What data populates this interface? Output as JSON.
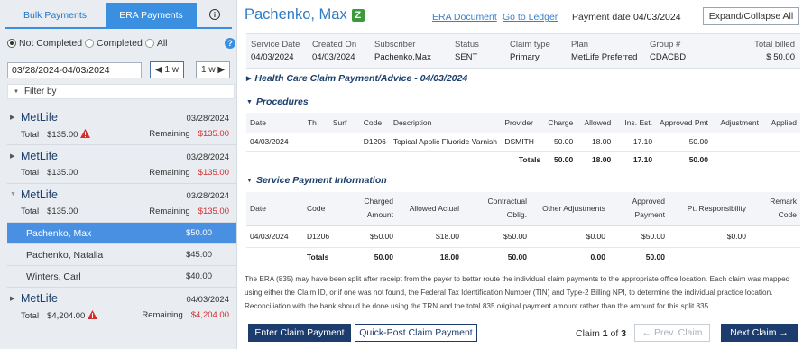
{
  "tabs": {
    "bulk": "Bulk Payments",
    "era": "ERA Payments",
    "info_icon": "i"
  },
  "filters": {
    "radios": [
      "Not Completed",
      "Completed",
      "All"
    ],
    "selected": "Not Completed",
    "date_range": "03/28/2024-04/03/2024",
    "prev_week": "1 w",
    "next_week": "1 w",
    "filter_by": "Filter by",
    "help_icon": "?"
  },
  "payers": [
    {
      "name": "MetLife",
      "date": "03/28/2024",
      "total_label": "Total",
      "total": "$135.00",
      "warning": true,
      "remaining_label": "Remaining",
      "remaining": "$135.00",
      "expanded": false
    },
    {
      "name": "MetLife",
      "date": "03/28/2024",
      "total_label": "Total",
      "total": "$135.00",
      "warning": false,
      "remaining_label": "Remaining",
      "remaining": "$135.00",
      "expanded": false
    },
    {
      "name": "MetLife",
      "date": "03/28/2024",
      "total_label": "Total",
      "total": "$135.00",
      "warning": false,
      "remaining_label": "Remaining",
      "remaining": "$135.00",
      "expanded": true,
      "claims": [
        {
          "name": "Pachenko, Max",
          "amount": "$50.00",
          "selected": true
        },
        {
          "name": "Pachenko, Natalia",
          "amount": "$45.00",
          "selected": false
        },
        {
          "name": "Winters, Carl",
          "amount": "$40.00",
          "selected": false
        }
      ]
    },
    {
      "name": "MetLife",
      "date": "04/03/2024",
      "total_label": "Total",
      "total": "$4,204.00",
      "warning": true,
      "remaining_label": "Remaining",
      "remaining": "$4,204.00",
      "expanded": false
    }
  ],
  "header": {
    "patient": "Pachenko, Max",
    "badge": "Z",
    "era_link": "ERA Document",
    "ledger_link": "Go to Ledger",
    "payment_date_label": "Payment date",
    "payment_date": "04/03/2024",
    "expand_btn": "Expand/Collapse All"
  },
  "summary": {
    "service_date": {
      "label": "Service Date",
      "value": "04/03/2024"
    },
    "created_on": {
      "label": "Created On",
      "value": "04/03/2024"
    },
    "subscriber": {
      "label": "Subscriber",
      "value": "Pachenko,Max"
    },
    "status": {
      "label": "Status",
      "value": "SENT"
    },
    "claim_type": {
      "label": "Claim type",
      "value": "Primary"
    },
    "plan": {
      "label": "Plan",
      "value": "MetLife Preferred"
    },
    "group": {
      "label": "Group #",
      "value": "CDACBD"
    },
    "total_billed": {
      "label": "Total billed",
      "value": "$ 50.00"
    }
  },
  "sections": {
    "advice": "Health Care Claim Payment/Advice - 04/03/2024",
    "procedures": "Procedures",
    "service_payment": "Service Payment Information"
  },
  "procedures": {
    "headers": [
      "Date",
      "Th",
      "Surf",
      "Code",
      "Description",
      "Provider",
      "Charge",
      "Allowed",
      "Ins. Est.",
      "Approved Pmt",
      "Adjustment",
      "Applied"
    ],
    "rows": [
      [
        "04/03/2024",
        "",
        "",
        "D1206",
        "Topical Applic Fluoride Varnish",
        "DSMITH",
        "50.00",
        "18.00",
        "17.10",
        "50.00",
        "",
        ""
      ]
    ],
    "totals": [
      "Totals",
      "50.00",
      "18.00",
      "17.10",
      "50.00"
    ]
  },
  "service_payment": {
    "headers": [
      "Date",
      "Code",
      "Charged Amount",
      "Allowed Actual",
      "Contractual Oblig.",
      "Other Adjustments",
      "Approved Payment",
      "Pt. Responsibility",
      "Remark Code"
    ],
    "rows": [
      [
        "04/03/2024",
        "D1206",
        "$50.00",
        "$18.00",
        "$50.00",
        "$0.00",
        "$50.00",
        "$0.00",
        ""
      ]
    ],
    "totals": [
      "Totals",
      "50.00",
      "18.00",
      "50.00",
      "0.00",
      "50.00"
    ]
  },
  "note": "The ERA (835) may have been split after receipt from the payer to better route the individual claim payments to the appropriate office location. Each claim was mapped using either the Claim ID, or if one was not found, the Federal Tax Identification Number (TIN) and Type-2 Billing NPI, to determine the individual practice location. Reconciliation with the bank should be done using the TRN and the total 835 original payment amount rather than the amount for this split 835.",
  "footer": {
    "enter_claim": "Enter Claim Payment",
    "quick_post": "Quick-Post Claim Payment",
    "claim_label": "Claim",
    "claim_current": "1",
    "claim_of": "of",
    "claim_total": "3",
    "prev_claim": "Prev. Claim",
    "next_claim": "Next Claim"
  },
  "colors": {
    "accent": "#3b8fe0",
    "navy": "#1d3c6e",
    "alert": "#d32f2f",
    "selected_row": "#4a90e2",
    "badge": "#3c9a3c"
  }
}
